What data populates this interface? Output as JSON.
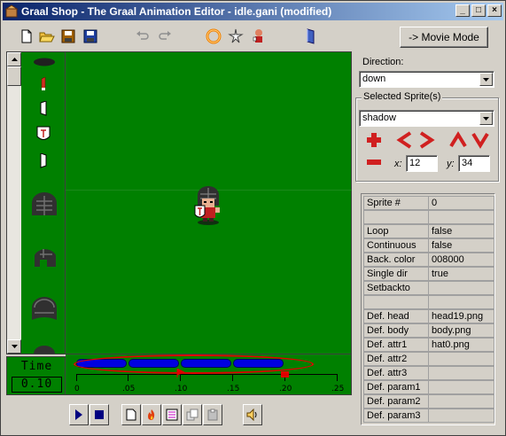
{
  "window": {
    "title": "Graal Shop - The Graal Animation Editor - idle.gani (modified)",
    "controls": {
      "minimize": "_",
      "maximize": "□",
      "close": "×"
    }
  },
  "toolbar": {
    "tools": [
      "new-file-icon",
      "open-folder-icon",
      "save-icon",
      "save-as-icon",
      "undo-icon",
      "redo-icon",
      "ring-icon",
      "sparkle-icon",
      "character-icon",
      "book-icon"
    ],
    "movie_mode_label": "-> Movie Mode"
  },
  "timeline": {
    "time_label": "Time",
    "time_value": "0.10",
    "ticks": [
      "0",
      ".05",
      ".10",
      ".15",
      ".20",
      ".25"
    ],
    "frame_count": 4
  },
  "transport": {
    "buttons": [
      "play-icon",
      "stop-icon",
      "new-frame-icon",
      "fire-icon",
      "paste-frame-icon",
      "copy-frame-icon",
      "paste-icon",
      "sound-icon"
    ]
  },
  "right": {
    "direction_label": "Direction:",
    "direction_value": "down",
    "selected_sprites_label": "Selected Sprite(s)",
    "sprite_value": "shadow",
    "x_label": "x:",
    "x_value": "12",
    "y_label": "y:",
    "y_value": "34"
  },
  "properties": [
    {
      "key": "Sprite #",
      "value": "0"
    },
    {
      "key": "",
      "value": ""
    },
    {
      "key": "Loop",
      "value": "false"
    },
    {
      "key": "Continuous",
      "value": "false"
    },
    {
      "key": "Back. color",
      "value": "008000"
    },
    {
      "key": "Single dir",
      "value": "true"
    },
    {
      "key": "Setbackto",
      "value": ""
    },
    {
      "key": "",
      "value": ""
    },
    {
      "key": "Def. head",
      "value": "head19.png"
    },
    {
      "key": "Def. body",
      "value": "body.png"
    },
    {
      "key": "Def. attr1",
      "value": "hat0.png"
    },
    {
      "key": "Def. attr2",
      "value": ""
    },
    {
      "key": "Def. attr3",
      "value": ""
    },
    {
      "key": "Def. param1",
      "value": ""
    },
    {
      "key": "Def. param2",
      "value": ""
    },
    {
      "key": "Def. param3",
      "value": ""
    }
  ],
  "colors": {
    "canvas_bg": "#008000",
    "frame_bar": "#0000e0",
    "highlight_ring": "#e00000",
    "title_gradient_start": "#0a246a"
  }
}
